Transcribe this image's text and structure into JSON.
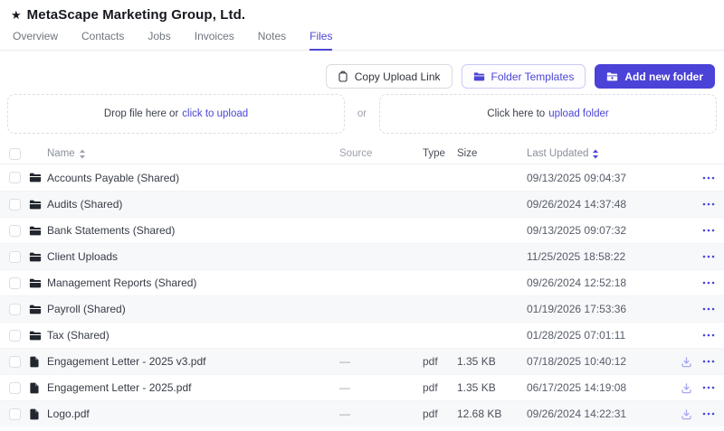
{
  "header": {
    "star_icon": "★",
    "title": "MetaScape Marketing Group, Ltd."
  },
  "tabs": [
    {
      "label": "Overview",
      "active": false
    },
    {
      "label": "Contacts",
      "active": false
    },
    {
      "label": "Jobs",
      "active": false
    },
    {
      "label": "Invoices",
      "active": false
    },
    {
      "label": "Notes",
      "active": false
    },
    {
      "label": "Files",
      "active": true
    }
  ],
  "toolbar": {
    "copy_upload_link_label": "Copy Upload Link",
    "folder_templates_label": "Folder Templates",
    "add_new_folder_label": "Add new folder"
  },
  "dropzones": {
    "file_prefix": "Drop file here or",
    "file_link": "click to upload",
    "separator": "or",
    "folder_prefix": "Click here to",
    "folder_link": "upload folder"
  },
  "table": {
    "columns": {
      "name": "Name",
      "source": "Source",
      "type": "Type",
      "size": "Size",
      "last_updated": "Last Updated"
    },
    "rows": [
      {
        "kind": "folder",
        "name": "Accounts Payable (Shared)",
        "source": "",
        "type": "",
        "size": "",
        "last_updated": "09/13/2025 09:04:37"
      },
      {
        "kind": "folder",
        "name": "Audits (Shared)",
        "source": "",
        "type": "",
        "size": "",
        "last_updated": "09/26/2024 14:37:48"
      },
      {
        "kind": "folder",
        "name": "Bank Statements (Shared)",
        "source": "",
        "type": "",
        "size": "",
        "last_updated": "09/13/2025 09:07:32"
      },
      {
        "kind": "folder",
        "name": "Client Uploads",
        "source": "",
        "type": "",
        "size": "",
        "last_updated": "11/25/2025 18:58:22"
      },
      {
        "kind": "folder",
        "name": "Management Reports (Shared)",
        "source": "",
        "type": "",
        "size": "",
        "last_updated": "09/26/2024 12:52:18"
      },
      {
        "kind": "folder",
        "name": "Payroll (Shared)",
        "source": "",
        "type": "",
        "size": "",
        "last_updated": "01/19/2026 17:53:36"
      },
      {
        "kind": "folder",
        "name": "Tax (Shared)",
        "source": "",
        "type": "",
        "size": "",
        "last_updated": "01/28/2025 07:01:11"
      },
      {
        "kind": "file",
        "name": "Engagement Letter - 2025 v3.pdf",
        "source": "—",
        "type": "pdf",
        "size": "1.35 KB",
        "last_updated": "07/18/2025 10:40:12"
      },
      {
        "kind": "file",
        "name": "Engagement Letter - 2025.pdf",
        "source": "—",
        "type": "pdf",
        "size": "1.35 KB",
        "last_updated": "06/17/2025 14:19:08"
      },
      {
        "kind": "file",
        "name": "Logo.pdf",
        "source": "—",
        "type": "pdf",
        "size": "12.68 KB",
        "last_updated": "09/26/2024 14:22:31"
      }
    ]
  },
  "colors": {
    "accent": "#4c46d6",
    "primary_button_bg": "#4b42d8",
    "row_alt_bg": "#f7f8fa",
    "icon_dark": "#22262e",
    "download_icon": "#a6a8ef"
  }
}
